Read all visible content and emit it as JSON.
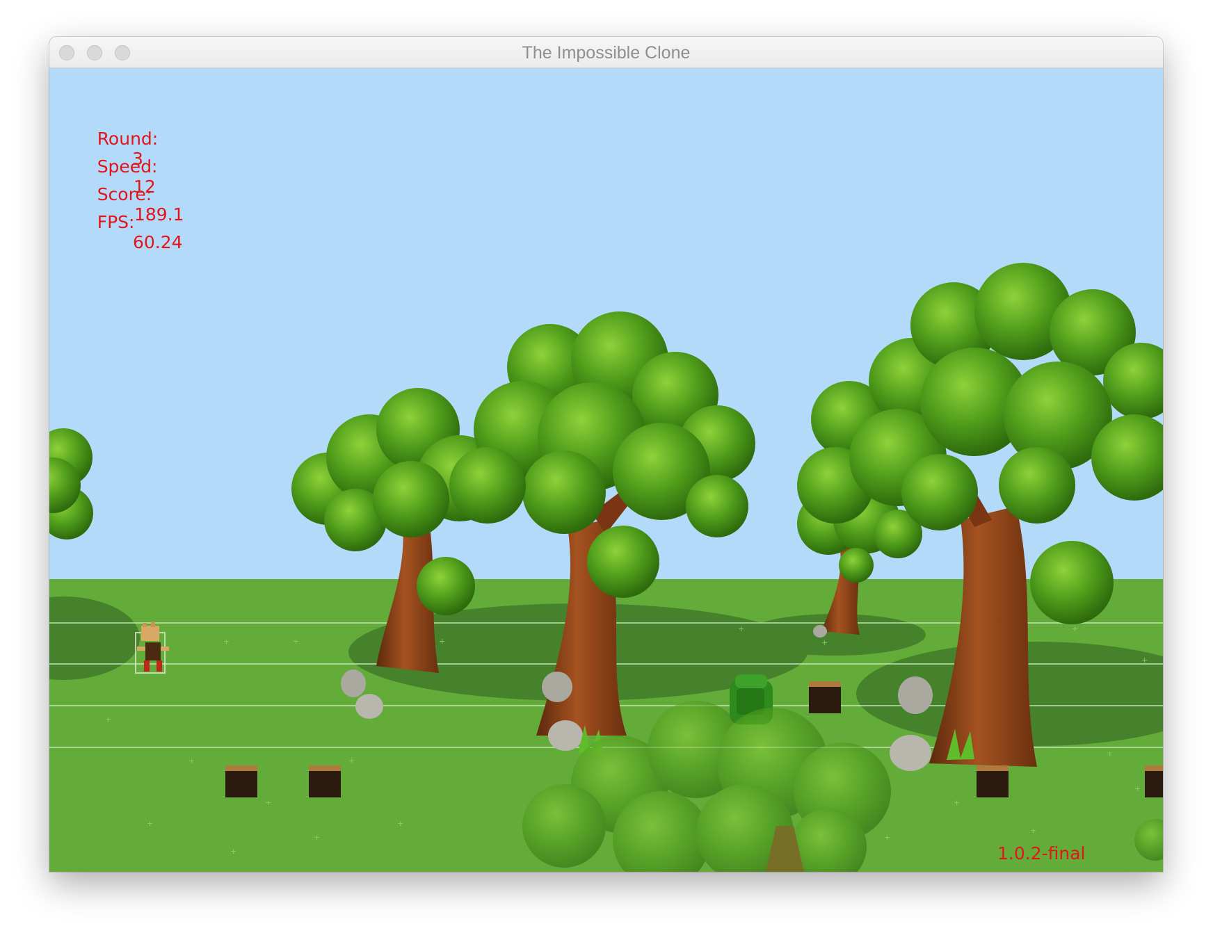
{
  "window": {
    "title": "The Impossible Clone",
    "traffic_lights": [
      "close-button",
      "minimize-button",
      "zoom-button"
    ]
  },
  "hud": {
    "round_label": "Round:",
    "round_value": "3",
    "speed_label": "Speed:",
    "speed_value": "12",
    "score_label": "Score:",
    "score_value": "189.1",
    "fps_label": "FPS:",
    "fps_value": "60.24"
  },
  "version": "1.0.2-final",
  "colors": {
    "hud_text": "#e3141a",
    "sky": "#b3daf8",
    "grass": "#63ac3a",
    "foliage": "#4e9a1c",
    "trunk": "#8a3f16"
  }
}
